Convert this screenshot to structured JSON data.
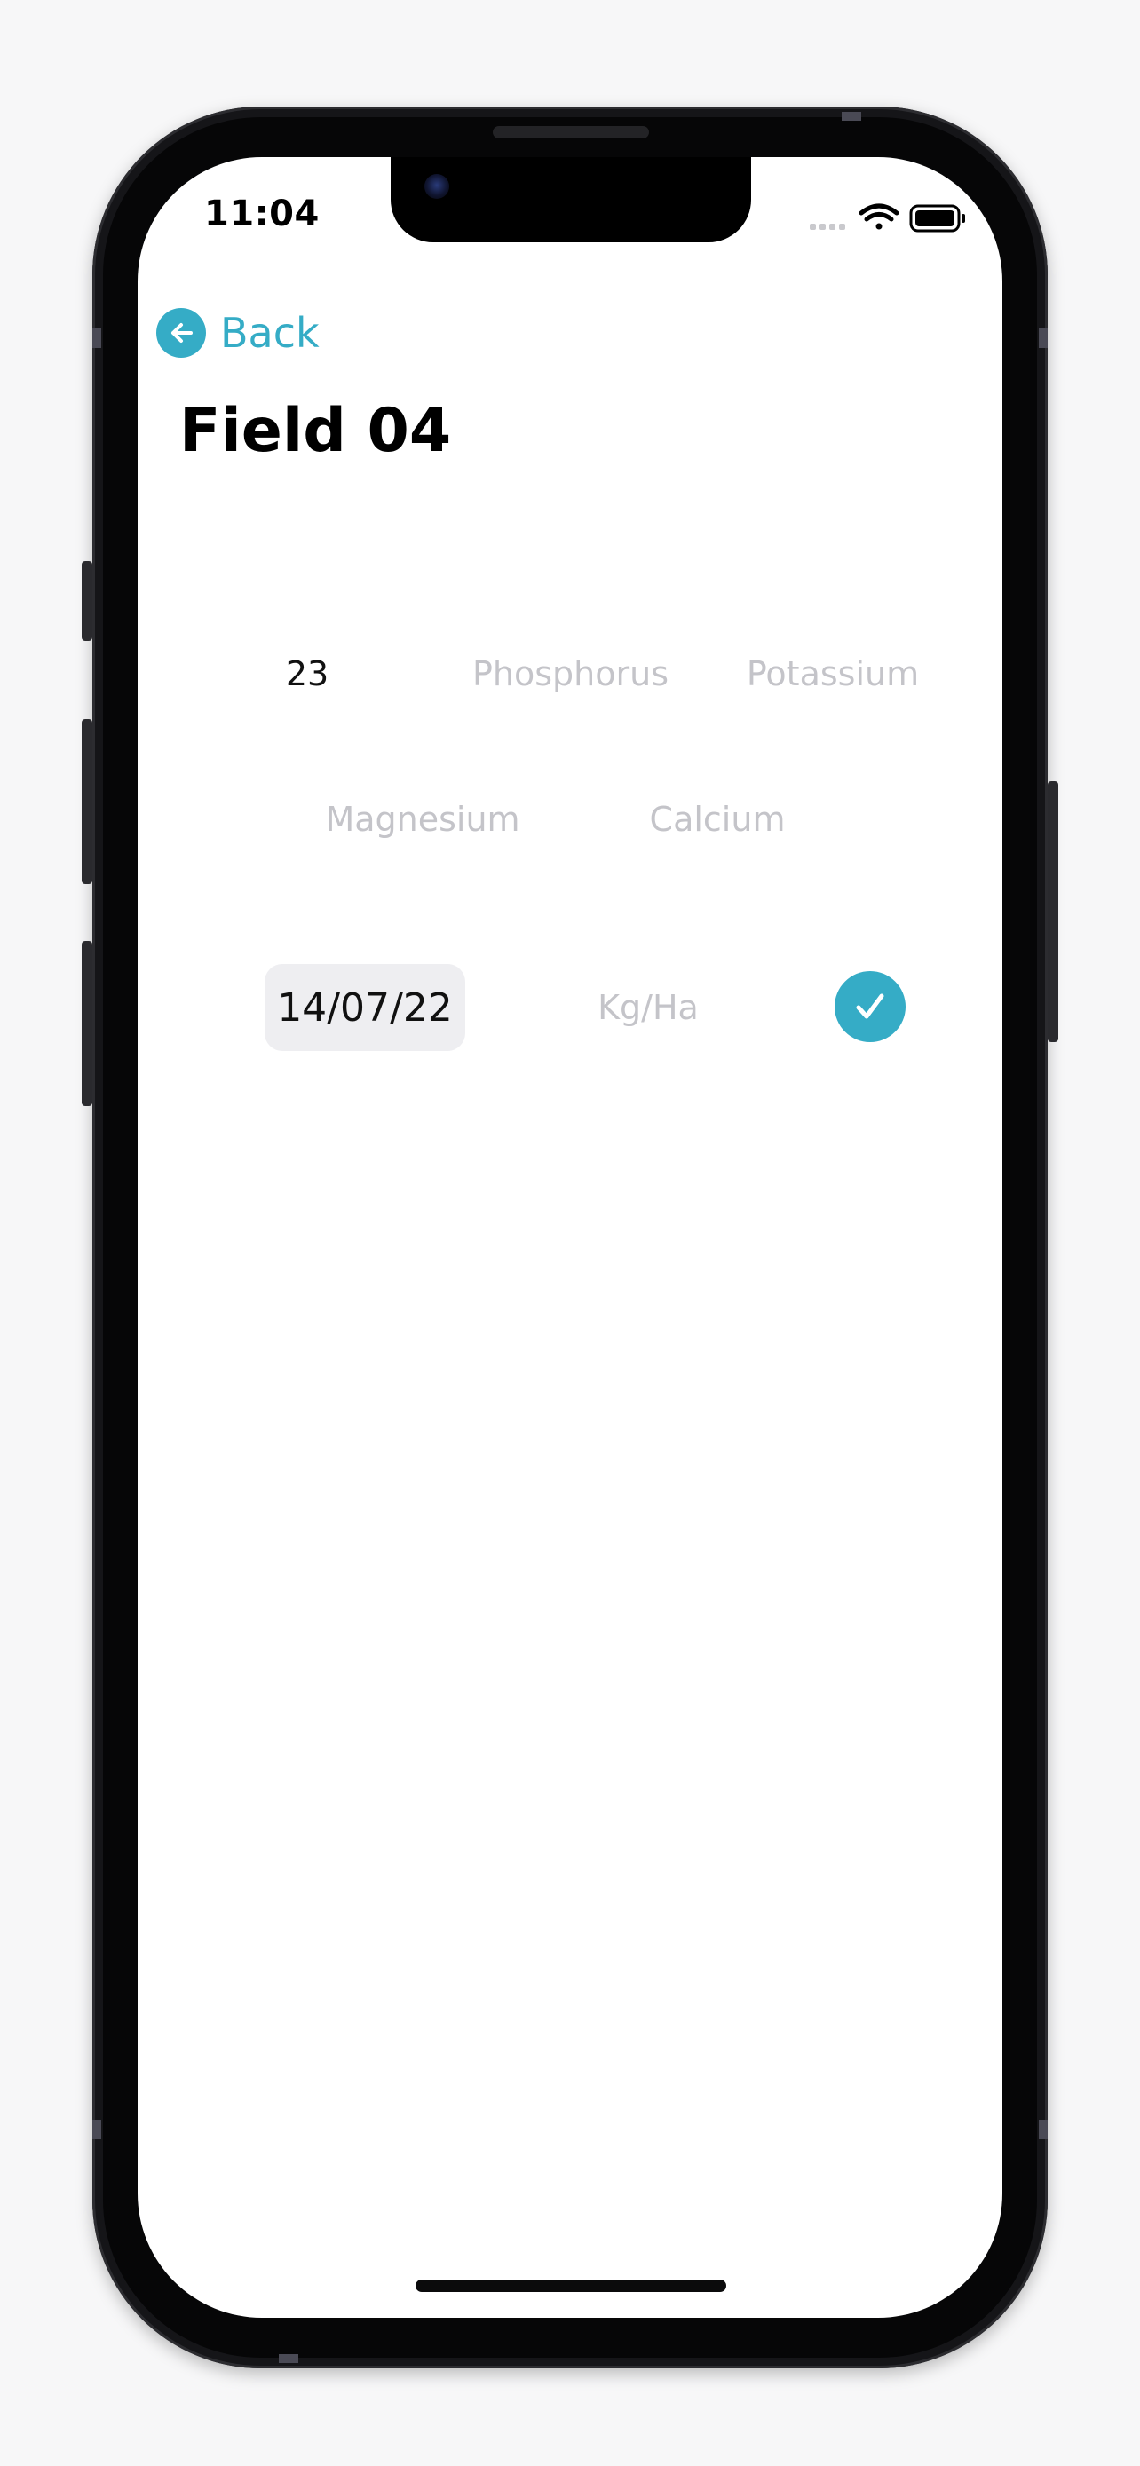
{
  "status_bar": {
    "time": "11:04"
  },
  "nav": {
    "back_label": "Back"
  },
  "page": {
    "title": "Field 04"
  },
  "nutrients": {
    "nitrogen_value": "23",
    "phosphorus_placeholder": "Phosphorus",
    "potassium_placeholder": "Potassium",
    "magnesium_placeholder": "Magnesium",
    "calcium_placeholder": "Calcium"
  },
  "entry": {
    "date": "14/07/22",
    "unit_placeholder": "Kg/Ha"
  },
  "icons": {
    "back": "arrow-left-circle-icon",
    "confirm": "checkmark-circle-icon",
    "signal": "cellular-signal-icon",
    "wifi": "wifi-icon",
    "battery": "battery-icon"
  },
  "colors": {
    "accent": "#35acc6",
    "placeholder": "#c4c4c9",
    "chip_background": "#eeeef1"
  }
}
